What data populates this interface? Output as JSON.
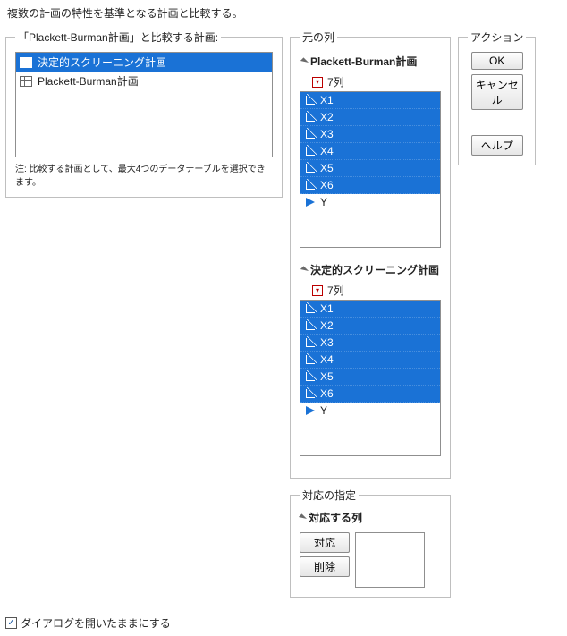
{
  "description": "複数の計画の特性を基準となる計画と比較する。",
  "compare_group": {
    "legend": "「Plackett-Burman計画」と比較する計画:",
    "items": [
      {
        "label": "決定的スクリーニング計画",
        "selected": true
      },
      {
        "label": "Plackett-Burman計画",
        "selected": false
      }
    ],
    "note": "注: 比較する計画として、最大4つのデータテーブルを選択できます。"
  },
  "source_cols": {
    "legend": "元の列",
    "groups": [
      {
        "title": "Plackett-Burman計画",
        "count_label": "7列",
        "cols": [
          {
            "label": "X1",
            "type": "cont",
            "sel": true
          },
          {
            "label": "X2",
            "type": "cont",
            "sel": true
          },
          {
            "label": "X3",
            "type": "cont",
            "sel": true
          },
          {
            "label": "X4",
            "type": "cont",
            "sel": true
          },
          {
            "label": "X5",
            "type": "cont",
            "sel": true
          },
          {
            "label": "X6",
            "type": "cont",
            "sel": true
          },
          {
            "label": "Y",
            "type": "resp",
            "sel": false
          }
        ]
      },
      {
        "title": "決定的スクリーニング計画",
        "count_label": "7列",
        "cols": [
          {
            "label": "X1",
            "type": "cont",
            "sel": true
          },
          {
            "label": "X2",
            "type": "cont",
            "sel": true
          },
          {
            "label": "X3",
            "type": "cont",
            "sel": true
          },
          {
            "label": "X4",
            "type": "cont",
            "sel": true
          },
          {
            "label": "X5",
            "type": "cont",
            "sel": true
          },
          {
            "label": "X6",
            "type": "cont",
            "sel": true
          },
          {
            "label": "Y",
            "type": "resp",
            "sel": false
          }
        ]
      }
    ]
  },
  "mapping": {
    "legend": "対応の指定",
    "header": "対応する列",
    "btn_match": "対応",
    "btn_delete": "削除"
  },
  "actions": {
    "legend": "アクション",
    "ok": "OK",
    "cancel": "キャンセル",
    "help": "ヘルプ"
  },
  "footer": {
    "keep_open": "ダイアログを開いたままにする",
    "checked": true
  }
}
